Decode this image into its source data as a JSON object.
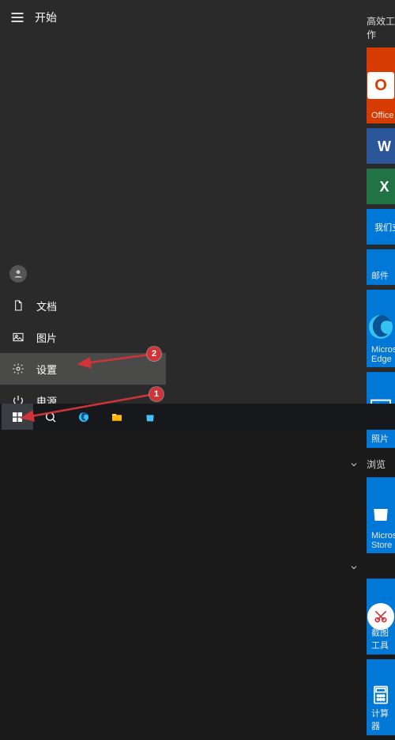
{
  "header": {
    "title": "开始"
  },
  "rail": {
    "user_name": "",
    "documents_label": "文档",
    "pictures_label": "图片",
    "settings_label": "设置",
    "power_label": "电源"
  },
  "groups": {
    "productivity": {
      "title": "高效工作"
    },
    "browse": {
      "title": "浏览"
    }
  },
  "tiles": {
    "office": {
      "label": "Office"
    },
    "edge": {
      "label": "Microsoft Edge"
    },
    "gmail_support": {
      "label": "我们支持 Gmail"
    },
    "mail": {
      "label": "邮件"
    },
    "photos": {
      "label": "照片"
    },
    "store": {
      "label": "Microsoft Store"
    },
    "snip": {
      "label": "截图工具"
    },
    "calc": {
      "label": "计算器"
    }
  },
  "annotations": {
    "marker1": "1",
    "marker2": "2"
  },
  "colors": {
    "accent": "#0078d7",
    "office": "#d83b01",
    "marker": "#d13438"
  }
}
